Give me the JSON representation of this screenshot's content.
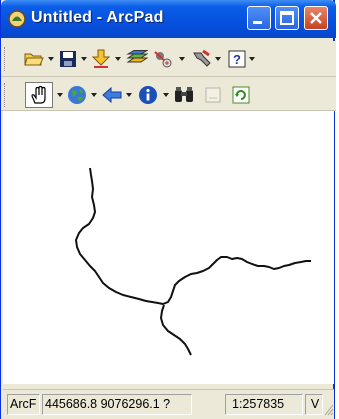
{
  "window": {
    "title": "Untitled - ArcPad"
  },
  "icons": {
    "toolbar1": [
      "open-folder-icon",
      "save-icon",
      "download-icon",
      "layers-icon",
      "gps-icon",
      "tools-icon",
      "help-icon"
    ],
    "toolbar2": [
      "pan-hand-icon",
      "globe-icon",
      "back-arrow-icon",
      "info-icon",
      "binoculars-icon",
      "scale-bar-icon",
      "refresh-icon"
    ]
  },
  "status": {
    "app": "ArcF",
    "coordinates": "445686.8 9076296.1 ?",
    "scale": "1:257835",
    "extra": "V"
  }
}
